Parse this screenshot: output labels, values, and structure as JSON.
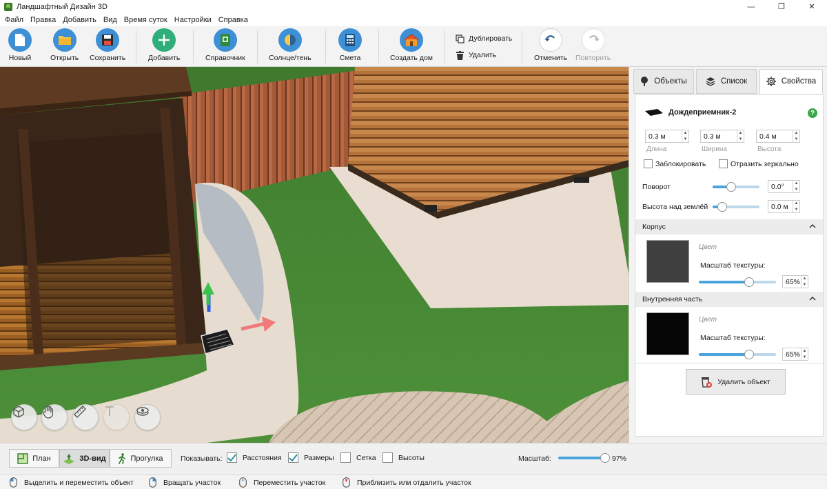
{
  "window": {
    "title": "Ландшафтный Дизайн 3D",
    "minimize": "—",
    "maximize": "❐",
    "close": "✕"
  },
  "menu": [
    "Файл",
    "Правка",
    "Добавить",
    "Вид",
    "Время суток",
    "Настройки",
    "Справка"
  ],
  "toolbar": {
    "new": "Новый",
    "open": "Открыть",
    "save": "Сохранить",
    "add": "Добавить",
    "reference": "Справочник",
    "sun": "Солнце/тень",
    "estimate": "Смета",
    "create_house": "Создать дом",
    "duplicate": "Дублировать",
    "delete": "Удалить",
    "undo": "Отменить",
    "redo": "Повторить"
  },
  "panel": {
    "tabs": [
      "Объекты",
      "Список",
      "Свойства"
    ],
    "active_tab": "Свойства",
    "object_name": "Дождеприемник-2",
    "help": "?",
    "dims": [
      {
        "value": "0.3 м",
        "label": "Длина"
      },
      {
        "value": "0.3 м",
        "label": "Ширина"
      },
      {
        "value": "0.4 м",
        "label": "Высота"
      }
    ],
    "lock_label": "Заблокировать",
    "lock_checked": false,
    "mirror_label": "Отразить зеркально",
    "mirror_checked": false,
    "rotation": {
      "label": "Поворот",
      "value": "0.0°",
      "level": 0.4
    },
    "elevation": {
      "label": "Высота над землёй",
      "value": "0.0 м",
      "level": 0.2
    },
    "sections": [
      {
        "title": "Корпус",
        "color_label": "Цвет",
        "color": "#404040",
        "scale_label": "Масштаб текстуры:",
        "scale_value": "65%",
        "scale_level": 0.65
      },
      {
        "title": "Внутренняя часть",
        "color_label": "Цвет",
        "color": "#050505",
        "scale_label": "Масштаб текстуры:",
        "scale_value": "65%",
        "scale_level": 0.65
      }
    ],
    "delete_object": "Удалить объект"
  },
  "view": {
    "tabs": [
      "План",
      "3D-вид",
      "Прогулка"
    ],
    "active_tab": "3D-вид",
    "show_label": "Показывать:",
    "show_options": [
      {
        "label": "Расстояния",
        "checked": true
      },
      {
        "label": "Размеры",
        "checked": true
      },
      {
        "label": "Сетка",
        "checked": false
      },
      {
        "label": "Высоты",
        "checked": false
      }
    ],
    "scale_label": "Масштаб:",
    "scale_value": "97%",
    "scale_level": 0.97
  },
  "status": [
    "Выделить и переместить объект",
    "Вращать участок",
    "Переместить участок",
    "Приблизить или отдалить участок"
  ],
  "colors": {
    "accent": "#4aa3dc",
    "help": "#3aa84a",
    "grass": "#4a8a38"
  }
}
